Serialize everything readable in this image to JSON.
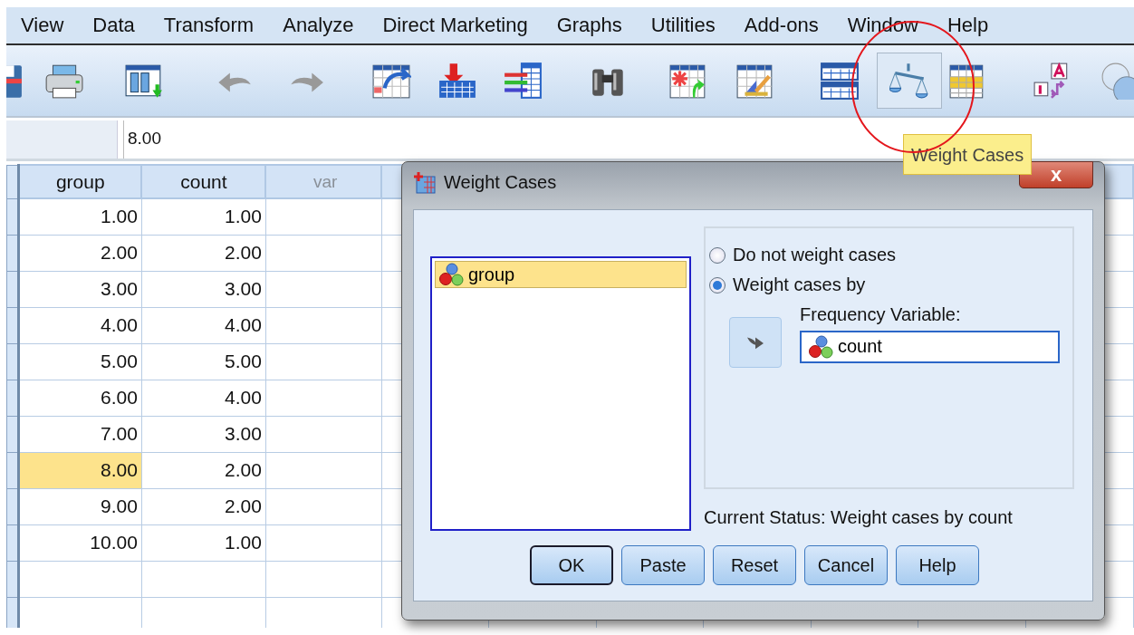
{
  "menu": [
    {
      "label": "View"
    },
    {
      "label": "Data"
    },
    {
      "label": "Transform"
    },
    {
      "label": "Analyze"
    },
    {
      "label": "Direct Marketing"
    },
    {
      "label": "Graphs"
    },
    {
      "label": "Utilities"
    },
    {
      "label": "Add-ons"
    },
    {
      "label": "Window"
    },
    {
      "label": "Help"
    }
  ],
  "toolbar": [
    {
      "kind": "save",
      "pressed": false
    },
    {
      "kind": "print",
      "pressed": false
    },
    {
      "kind": "recall",
      "pressed": false
    },
    {
      "kind": "undo",
      "pressed": false
    },
    {
      "kind": "redo",
      "pressed": false
    },
    {
      "kind": "goto",
      "pressed": false
    },
    {
      "kind": "insert-case",
      "pressed": false
    },
    {
      "kind": "variables",
      "pressed": false
    },
    {
      "kind": "find",
      "pressed": false
    },
    {
      "kind": "insert-variable",
      "pressed": false
    },
    {
      "kind": "split",
      "pressed": false
    },
    {
      "kind": "split-file",
      "pressed": false
    },
    {
      "kind": "weight",
      "pressed": true
    },
    {
      "kind": "select",
      "pressed": false
    },
    {
      "kind": "labels",
      "pressed": false
    },
    {
      "kind": "sets",
      "pressed": false
    }
  ],
  "cell_editor": {
    "value": "8.00"
  },
  "grid": {
    "columns": [
      {
        "label": "group",
        "kind": "variable"
      },
      {
        "label": "count",
        "kind": "variable"
      },
      {
        "label": "var",
        "kind": "empty"
      }
    ],
    "rows": [
      {
        "cells": [
          {
            "text": "1.00",
            "selected": false
          },
          {
            "text": "1.00",
            "selected": false
          }
        ]
      },
      {
        "cells": [
          {
            "text": "2.00",
            "selected": false
          },
          {
            "text": "2.00",
            "selected": false
          }
        ]
      },
      {
        "cells": [
          {
            "text": "3.00",
            "selected": false
          },
          {
            "text": "3.00",
            "selected": false
          }
        ]
      },
      {
        "cells": [
          {
            "text": "4.00",
            "selected": false
          },
          {
            "text": "4.00",
            "selected": false
          }
        ]
      },
      {
        "cells": [
          {
            "text": "5.00",
            "selected": false
          },
          {
            "text": "5.00",
            "selected": false
          }
        ]
      },
      {
        "cells": [
          {
            "text": "6.00",
            "selected": false
          },
          {
            "text": "4.00",
            "selected": false
          }
        ]
      },
      {
        "cells": [
          {
            "text": "7.00",
            "selected": false
          },
          {
            "text": "3.00",
            "selected": false
          }
        ]
      },
      {
        "cells": [
          {
            "text": "8.00",
            "selected": true
          },
          {
            "text": "2.00",
            "selected": false
          }
        ]
      },
      {
        "cells": [
          {
            "text": "9.00",
            "selected": false
          },
          {
            "text": "2.00",
            "selected": false
          }
        ]
      },
      {
        "cells": [
          {
            "text": "10.00",
            "selected": false
          },
          {
            "text": "1.00",
            "selected": false
          }
        ]
      }
    ]
  },
  "tooltip": {
    "text": "Weight Cases"
  },
  "annotation": {
    "kind": "circle"
  },
  "dialog": {
    "title": "Weight Cases",
    "close": "x",
    "source_list": [
      {
        "name": "group",
        "selected": true
      }
    ],
    "options": [
      {
        "label": "Do not weight cases",
        "selected": false
      },
      {
        "label": "Weight cases by",
        "selected": true
      }
    ],
    "frequency_label": "Frequency Variable:",
    "frequency_value": "count",
    "status": "Current Status: Weight cases by count",
    "buttons": [
      {
        "label": "OK",
        "default": true
      },
      {
        "label": "Paste",
        "default": false
      },
      {
        "label": "Reset",
        "default": false
      },
      {
        "label": "Cancel",
        "default": false
      },
      {
        "label": "Help",
        "default": false
      }
    ]
  }
}
